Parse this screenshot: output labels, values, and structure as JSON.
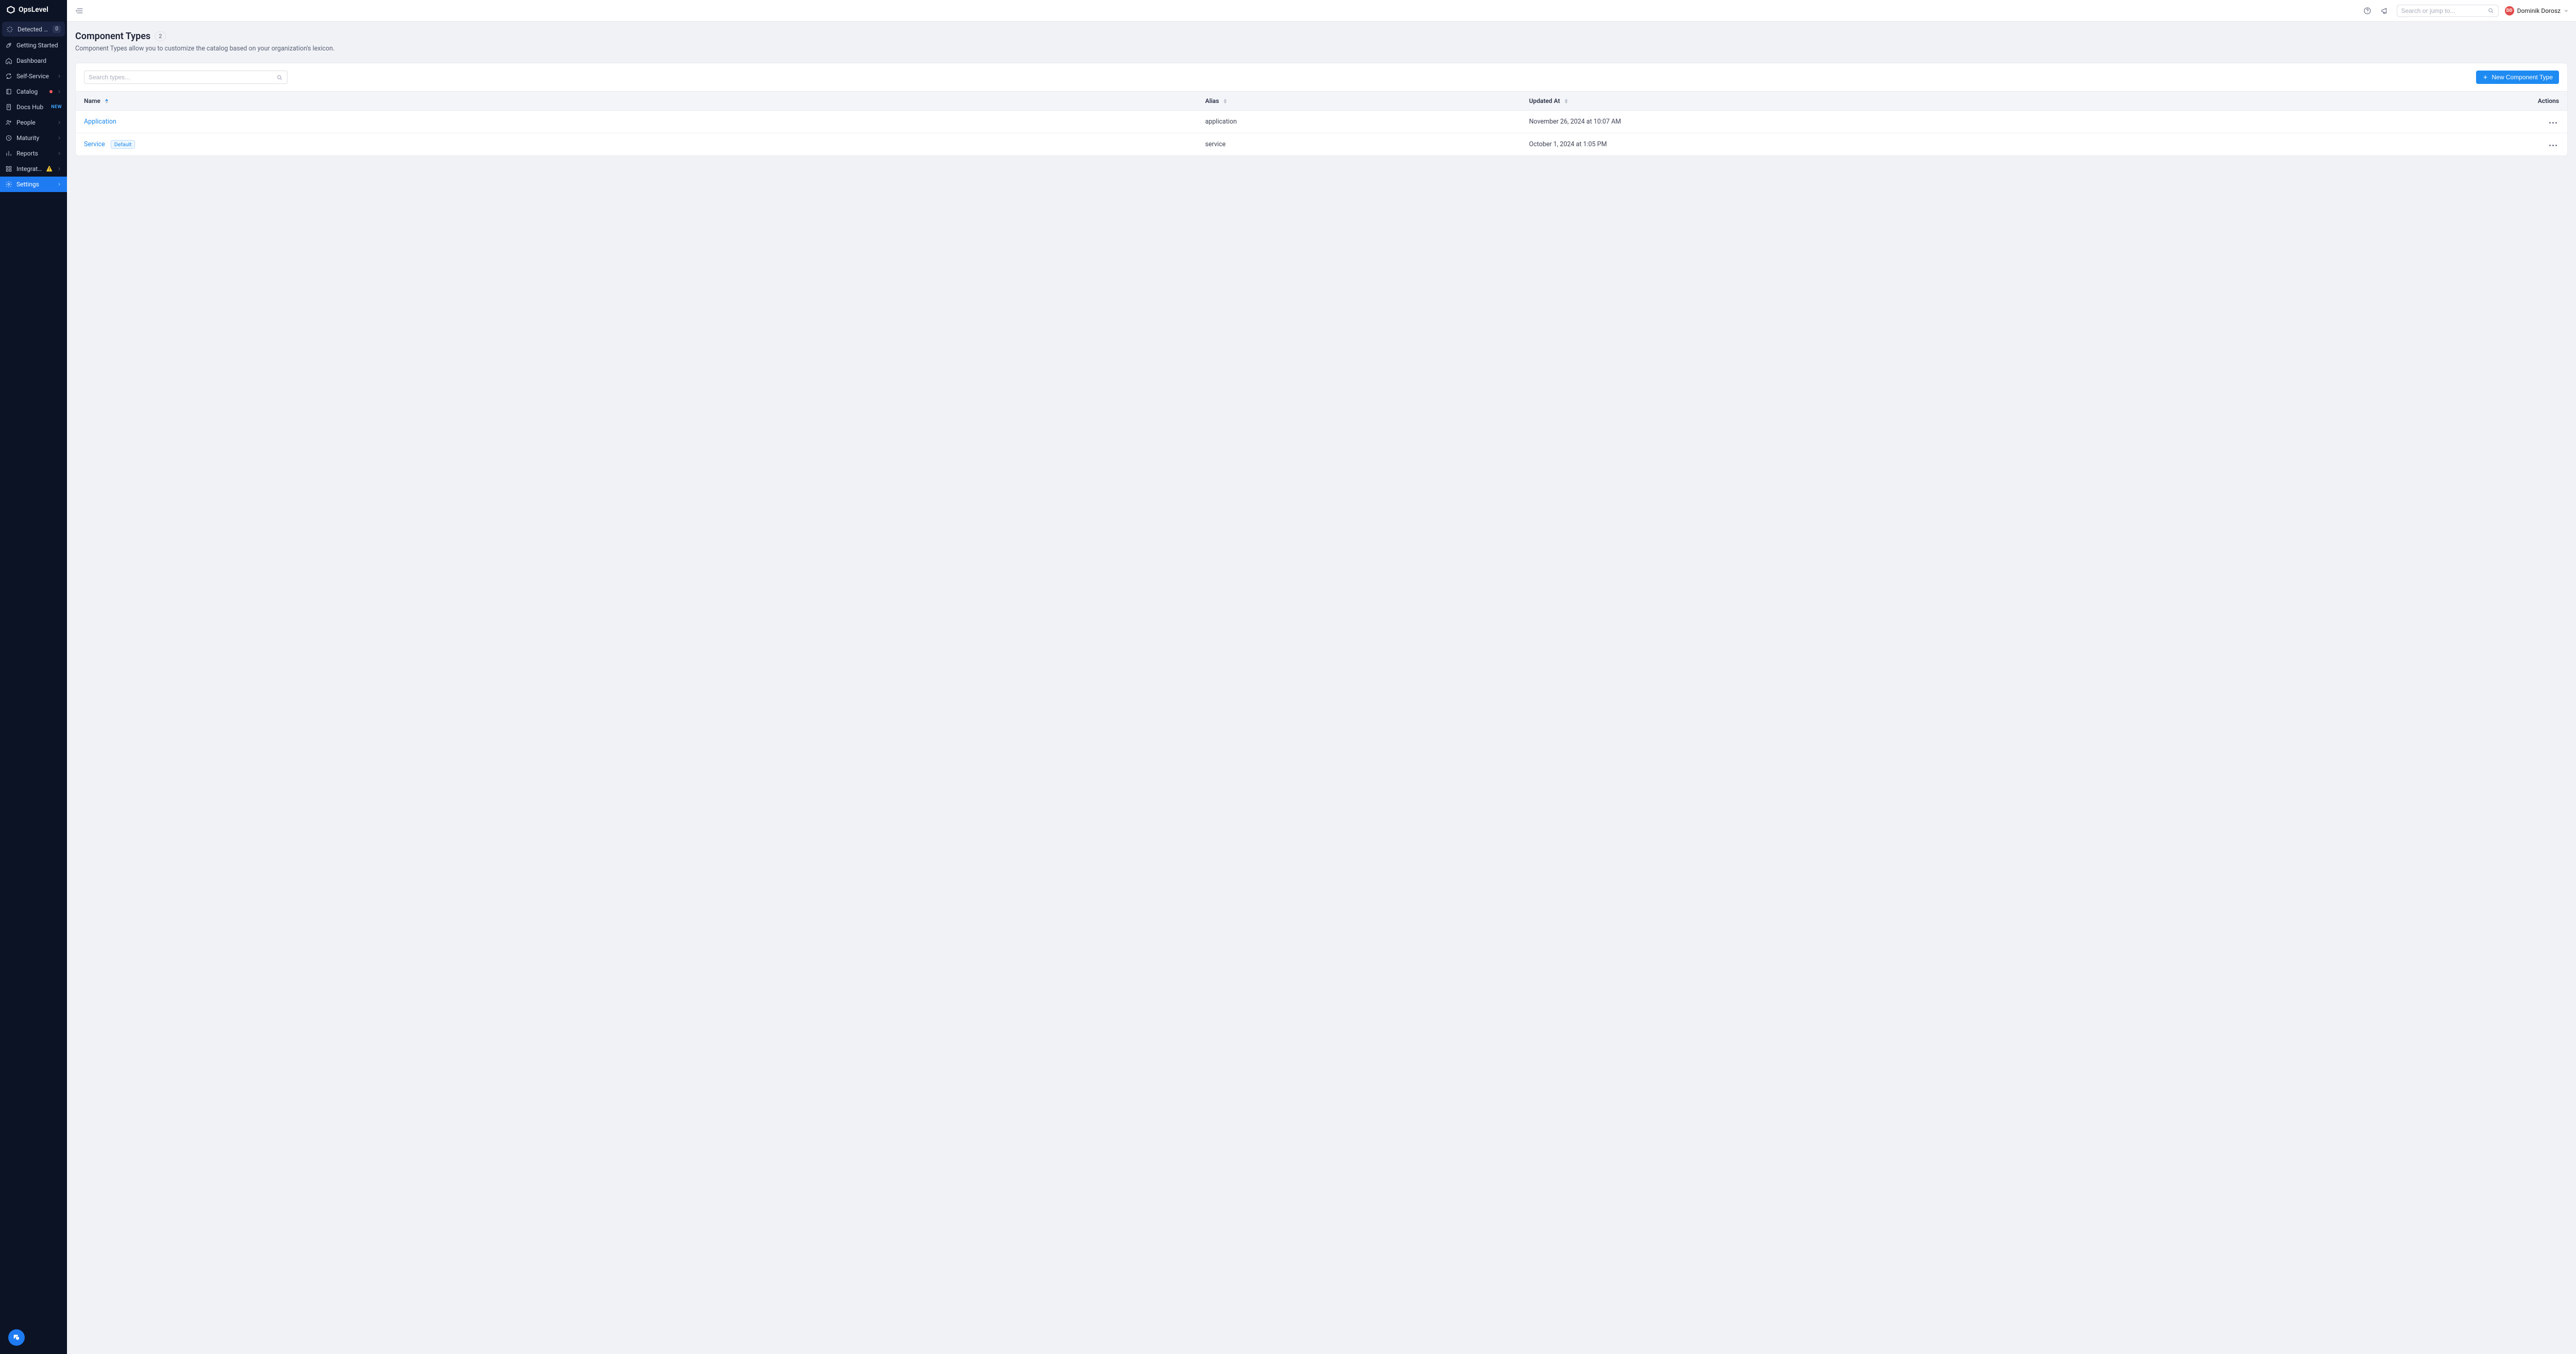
{
  "brand": {
    "name": "OpsLevel"
  },
  "sidebar": {
    "items": [
      {
        "label": "Detected Services",
        "count": "0",
        "icon": "sparkle"
      },
      {
        "label": "Getting Started",
        "icon": "rocket"
      },
      {
        "label": "Dashboard",
        "icon": "home"
      },
      {
        "label": "Self-Service",
        "icon": "refresh",
        "expandable": true
      },
      {
        "label": "Catalog",
        "icon": "book",
        "expandable": true,
        "dot": true
      },
      {
        "label": "Docs Hub",
        "icon": "doc",
        "new_badge": "NEW"
      },
      {
        "label": "People",
        "icon": "people",
        "expandable": true
      },
      {
        "label": "Maturity",
        "icon": "clock",
        "expandable": true
      },
      {
        "label": "Reports",
        "icon": "bar",
        "expandable": true
      },
      {
        "label": "Integrations",
        "icon": "grid",
        "expandable": true,
        "warn": true
      },
      {
        "label": "Settings",
        "icon": "gear",
        "expandable": true,
        "active": true
      }
    ]
  },
  "topbar": {
    "search_placeholder": "Search or jump to...",
    "user_initials": "DD",
    "user_name": "Dominik Dorosz"
  },
  "page": {
    "title": "Component Types",
    "count": "2",
    "description": "Component Types allow you to customize the catalog based on your organization's lexicon."
  },
  "toolbar": {
    "search_placeholder": "Search types...",
    "new_button": "New Component Type"
  },
  "table": {
    "columns": {
      "name": "Name",
      "alias": "Alias",
      "updated": "Updated At",
      "actions": "Actions"
    },
    "rows": [
      {
        "name": "Application",
        "alias": "application",
        "updated": "November 26, 2024 at 10:07 AM",
        "default": false
      },
      {
        "name": "Service",
        "alias": "service",
        "updated": "October 1, 2024 at 1:05 PM",
        "default": true,
        "default_label": "Default"
      }
    ]
  }
}
